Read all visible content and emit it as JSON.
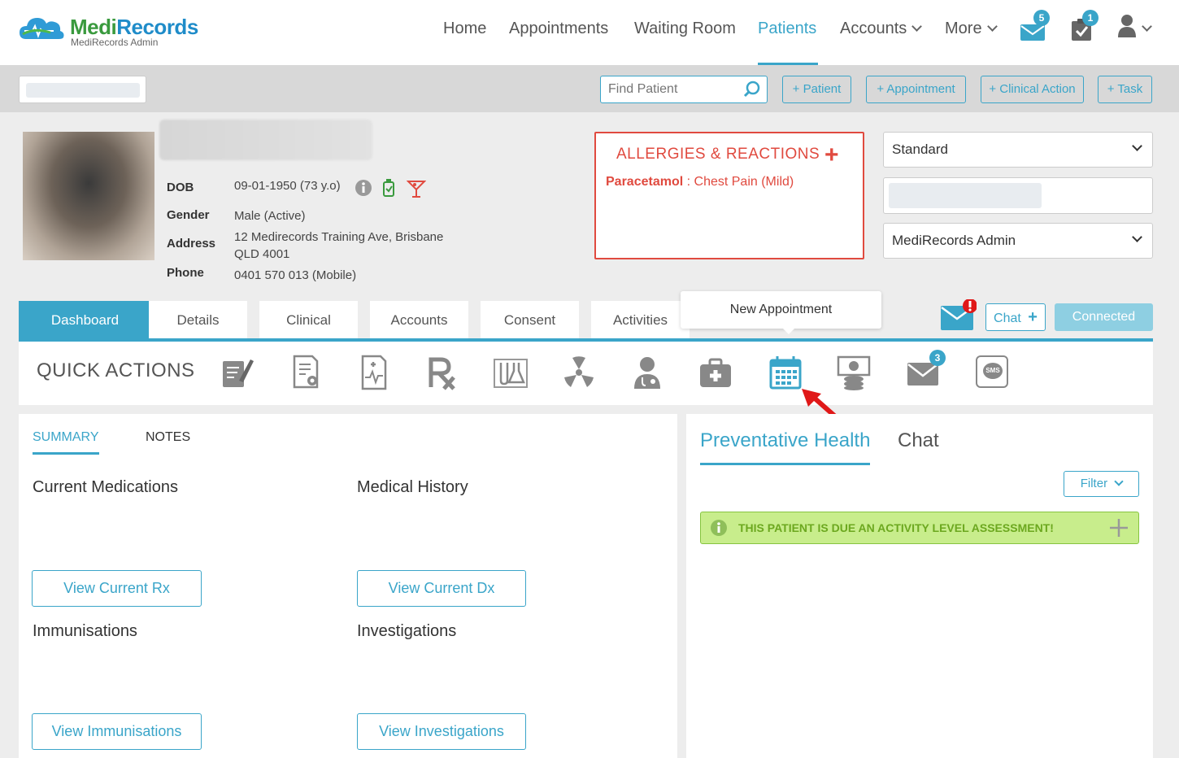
{
  "brand": {
    "name_part1": "Medi",
    "name_part2": "Records",
    "subtitle": "MediRecords Admin"
  },
  "nav": {
    "home": "Home",
    "appointments": "Appointments",
    "waiting_room": "Waiting Room",
    "patients": "Patients",
    "accounts": "Accounts",
    "more": "More",
    "messages_badge": "5",
    "tasks_badge": "1"
  },
  "toolbar": {
    "find_patient_placeholder": "Find Patient",
    "add_patient": "+ Patient",
    "add_appointment": "+ Appointment",
    "add_clinical_action": "+ Clinical Action",
    "add_task": "+ Task"
  },
  "patient": {
    "dob_label": "DOB",
    "dob_value": "09-01-1950 (73 y.o)",
    "gender_label": "Gender",
    "gender_value": "Male (Active)",
    "address_label": "Address",
    "address_line1": "12 Medirecords Training Ave, Brisbane",
    "address_line2": "QLD 4001",
    "phone_label": "Phone",
    "phone_value": "0401 570 013 (Mobile)"
  },
  "allergies": {
    "title": "ALLERGIES & REACTIONS",
    "item_name": "Paracetamol",
    "item_separator": " : ",
    "item_reaction": "Chest Pain (Mild)"
  },
  "selects": {
    "billing": "Standard",
    "practitioner": "MediRecords Admin"
  },
  "tabs": [
    "Dashboard",
    "Details",
    "Clinical",
    "Accounts",
    "Consent",
    "Activities"
  ],
  "tooltip": "New Appointment",
  "chat_button": "Chat",
  "connected_button": "Connected",
  "quick_actions": {
    "title": "QUICK ACTIONS",
    "mail_badge": "3",
    "sms_label": "SMS"
  },
  "summary": {
    "tab_summary": "SUMMARY",
    "tab_notes": "NOTES",
    "current_medications": "Current Medications",
    "medical_history": "Medical History",
    "immunisations": "Immunisations",
    "investigations": "Investigations",
    "view_rx": "View Current Rx",
    "view_dx": "View Current Dx",
    "view_immunisations": "View Immunisations",
    "view_investigations": "View Investigations"
  },
  "right_panel": {
    "tab_preventative": "Preventative Health",
    "tab_chat": "Chat",
    "filter": "Filter",
    "alert": "THIS PATIENT IS DUE AN ACTIVITY LEVEL ASSESSMENT!"
  },
  "colors": {
    "accent": "#3aa5c9",
    "danger": "#e04a3f",
    "success_bg": "#c8ed8c"
  }
}
